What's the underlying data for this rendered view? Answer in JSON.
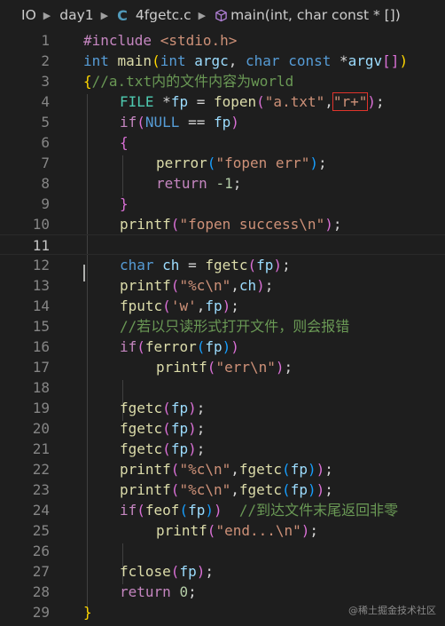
{
  "breadcrumb": {
    "items": [
      "IO",
      "day1",
      "4fgetc.c",
      "main(int, char const * [])"
    ]
  },
  "current_line": 11,
  "lines": [
    {
      "n": "1",
      "tokens": [
        [
          "#include ",
          "ctl"
        ],
        [
          "<stdio.h>",
          "str"
        ]
      ]
    },
    {
      "n": "2",
      "tokens": [
        [
          "int ",
          "kw"
        ],
        [
          "main",
          "fn"
        ],
        [
          "(",
          "b1"
        ],
        [
          "int ",
          "kw"
        ],
        [
          "argc",
          "var"
        ],
        [
          ", ",
          "plain"
        ],
        [
          "char ",
          "kw"
        ],
        [
          "const ",
          "kw"
        ],
        [
          "*",
          "plain"
        ],
        [
          "argv",
          "var"
        ],
        [
          "[]",
          "b2"
        ],
        [
          ")",
          "b1"
        ]
      ]
    },
    {
      "n": "3",
      "tokens": [
        [
          "{",
          "b1"
        ],
        [
          "//a.txt内的文件内容为world",
          "com"
        ]
      ]
    },
    {
      "n": "4",
      "tokens": [
        [
          "FILE ",
          "typ"
        ],
        [
          "*",
          "plain"
        ],
        [
          "fp",
          "var"
        ],
        [
          " = ",
          "plain"
        ],
        [
          "fopen",
          "fn"
        ],
        [
          "(",
          "b2"
        ],
        [
          "\"a.txt\"",
          "str"
        ],
        [
          ",",
          "plain"
        ],
        [
          "\"r+\"",
          "str",
          "redbox"
        ],
        [
          ")",
          "b2"
        ],
        [
          ";",
          "plain"
        ]
      ]
    },
    {
      "n": "5",
      "tokens": [
        [
          "if",
          "ctl"
        ],
        [
          "(",
          "b2"
        ],
        [
          "NULL",
          "kw"
        ],
        [
          " == ",
          "plain"
        ],
        [
          "fp",
          "var"
        ],
        [
          ")",
          "b2"
        ]
      ]
    },
    {
      "n": "6",
      "tokens": [
        [
          "{",
          "b2"
        ]
      ]
    },
    {
      "n": "7",
      "tokens": [
        [
          "perror",
          "fn"
        ],
        [
          "(",
          "b3"
        ],
        [
          "\"fopen err\"",
          "str"
        ],
        [
          ")",
          "b3"
        ],
        [
          ";",
          "plain"
        ]
      ]
    },
    {
      "n": "8",
      "tokens": [
        [
          "return ",
          "ctl"
        ],
        [
          "-1",
          "num"
        ],
        [
          ";",
          "plain"
        ]
      ]
    },
    {
      "n": "9",
      "tokens": [
        [
          "}",
          "b2"
        ]
      ]
    },
    {
      "n": "10",
      "tokens": [
        [
          "printf",
          "fn"
        ],
        [
          "(",
          "b2"
        ],
        [
          "\"fopen success\\n\"",
          "str"
        ],
        [
          ")",
          "b2"
        ],
        [
          ";",
          "plain"
        ]
      ]
    },
    {
      "n": "11",
      "tokens": []
    },
    {
      "n": "12",
      "tokens": [
        [
          "char ",
          "kw"
        ],
        [
          "ch",
          "var"
        ],
        [
          " = ",
          "plain"
        ],
        [
          "fgetc",
          "fn"
        ],
        [
          "(",
          "b2"
        ],
        [
          "fp",
          "var"
        ],
        [
          ")",
          "b2"
        ],
        [
          ";",
          "plain"
        ]
      ]
    },
    {
      "n": "13",
      "tokens": [
        [
          "printf",
          "fn"
        ],
        [
          "(",
          "b2"
        ],
        [
          "\"%c\\n\"",
          "str"
        ],
        [
          ",",
          "plain"
        ],
        [
          "ch",
          "var"
        ],
        [
          ")",
          "b2"
        ],
        [
          ";",
          "plain"
        ]
      ]
    },
    {
      "n": "14",
      "tokens": [
        [
          "fputc",
          "fn"
        ],
        [
          "(",
          "b2"
        ],
        [
          "'w'",
          "str"
        ],
        [
          ",",
          "plain"
        ],
        [
          "fp",
          "var"
        ],
        [
          ")",
          "b2"
        ],
        [
          ";",
          "plain"
        ]
      ]
    },
    {
      "n": "15",
      "tokens": [
        [
          "//若以只读形式打开文件，则会报错",
          "com"
        ]
      ]
    },
    {
      "n": "16",
      "tokens": [
        [
          "if",
          "ctl"
        ],
        [
          "(",
          "b2"
        ],
        [
          "ferror",
          "fn"
        ],
        [
          "(",
          "b3"
        ],
        [
          "fp",
          "var"
        ],
        [
          ")",
          "b3"
        ],
        [
          ")",
          "b2"
        ]
      ]
    },
    {
      "n": "17",
      "tokens": [
        [
          "printf",
          "fn"
        ],
        [
          "(",
          "b2"
        ],
        [
          "\"err\\n\"",
          "str"
        ],
        [
          ")",
          "b2"
        ],
        [
          ";",
          "plain"
        ]
      ]
    },
    {
      "n": "18",
      "tokens": []
    },
    {
      "n": "19",
      "tokens": [
        [
          "fgetc",
          "fn"
        ],
        [
          "(",
          "b2"
        ],
        [
          "fp",
          "var"
        ],
        [
          ")",
          "b2"
        ],
        [
          ";",
          "plain"
        ]
      ]
    },
    {
      "n": "20",
      "tokens": [
        [
          "fgetc",
          "fn"
        ],
        [
          "(",
          "b2"
        ],
        [
          "fp",
          "var"
        ],
        [
          ")",
          "b2"
        ],
        [
          ";",
          "plain"
        ]
      ]
    },
    {
      "n": "21",
      "tokens": [
        [
          "fgetc",
          "fn"
        ],
        [
          "(",
          "b2"
        ],
        [
          "fp",
          "var"
        ],
        [
          ")",
          "b2"
        ],
        [
          ";",
          "plain"
        ]
      ]
    },
    {
      "n": "22",
      "tokens": [
        [
          "printf",
          "fn"
        ],
        [
          "(",
          "b2"
        ],
        [
          "\"%c\\n\"",
          "str"
        ],
        [
          ",",
          "plain"
        ],
        [
          "fgetc",
          "fn"
        ],
        [
          "(",
          "b3"
        ],
        [
          "fp",
          "var"
        ],
        [
          ")",
          "b3"
        ],
        [
          ")",
          "b2"
        ],
        [
          ";",
          "plain"
        ]
      ]
    },
    {
      "n": "23",
      "tokens": [
        [
          "printf",
          "fn"
        ],
        [
          "(",
          "b2"
        ],
        [
          "\"%c\\n\"",
          "str"
        ],
        [
          ",",
          "plain"
        ],
        [
          "fgetc",
          "fn"
        ],
        [
          "(",
          "b3"
        ],
        [
          "fp",
          "var"
        ],
        [
          ")",
          "b3"
        ],
        [
          ")",
          "b2"
        ],
        [
          ";",
          "plain"
        ]
      ]
    },
    {
      "n": "24",
      "tokens": [
        [
          "if",
          "ctl"
        ],
        [
          "(",
          "b2"
        ],
        [
          "feof",
          "fn"
        ],
        [
          "(",
          "b3"
        ],
        [
          "fp",
          "var"
        ],
        [
          ")",
          "b3"
        ],
        [
          ")",
          "b2"
        ],
        [
          "  ",
          "plain"
        ],
        [
          "//到达文件末尾返回非零",
          "com"
        ]
      ]
    },
    {
      "n": "25",
      "tokens": [
        [
          "printf",
          "fn"
        ],
        [
          "(",
          "b2"
        ],
        [
          "\"end...\\n\"",
          "str"
        ],
        [
          ")",
          "b2"
        ],
        [
          ";",
          "plain"
        ]
      ]
    },
    {
      "n": "26",
      "tokens": []
    },
    {
      "n": "27",
      "tokens": [
        [
          "fclose",
          "fn"
        ],
        [
          "(",
          "b2"
        ],
        [
          "fp",
          "var"
        ],
        [
          ")",
          "b2"
        ],
        [
          ";",
          "plain"
        ]
      ]
    },
    {
      "n": "28",
      "tokens": [
        [
          "return ",
          "ctl"
        ],
        [
          "0",
          "num"
        ],
        [
          ";",
          "plain"
        ]
      ]
    },
    {
      "n": "29",
      "tokens": [
        [
          "}",
          "b1"
        ]
      ]
    }
  ],
  "watermark": "@稀土掘金技术社区"
}
